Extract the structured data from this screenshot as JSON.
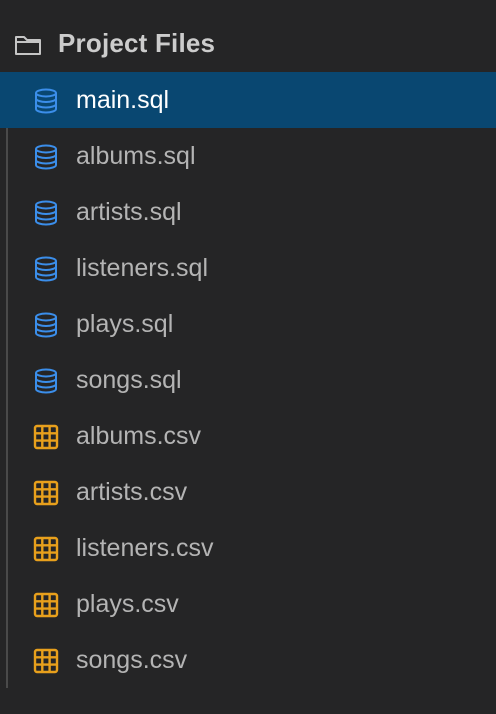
{
  "explorer": {
    "folder_icon": "folder-icon",
    "title": "Project Files",
    "colors": {
      "background": "#252526",
      "selected_row": "#094771",
      "sql_icon": "#3b8eea",
      "csv_icon": "#e8a01c",
      "text": "#b4b4b4",
      "selected_text": "#ffffff"
    },
    "files": [
      {
        "name": "main.sql",
        "icon": "database-icon",
        "selected": true
      },
      {
        "name": "albums.sql",
        "icon": "database-icon",
        "selected": false
      },
      {
        "name": "artists.sql",
        "icon": "database-icon",
        "selected": false
      },
      {
        "name": "listeners.sql",
        "icon": "database-icon",
        "selected": false
      },
      {
        "name": "plays.sql",
        "icon": "database-icon",
        "selected": false
      },
      {
        "name": "songs.sql",
        "icon": "database-icon",
        "selected": false
      },
      {
        "name": "albums.csv",
        "icon": "table-icon",
        "selected": false
      },
      {
        "name": "artists.csv",
        "icon": "table-icon",
        "selected": false
      },
      {
        "name": "listeners.csv",
        "icon": "table-icon",
        "selected": false
      },
      {
        "name": "plays.csv",
        "icon": "table-icon",
        "selected": false
      },
      {
        "name": "songs.csv",
        "icon": "table-icon",
        "selected": false
      }
    ]
  }
}
